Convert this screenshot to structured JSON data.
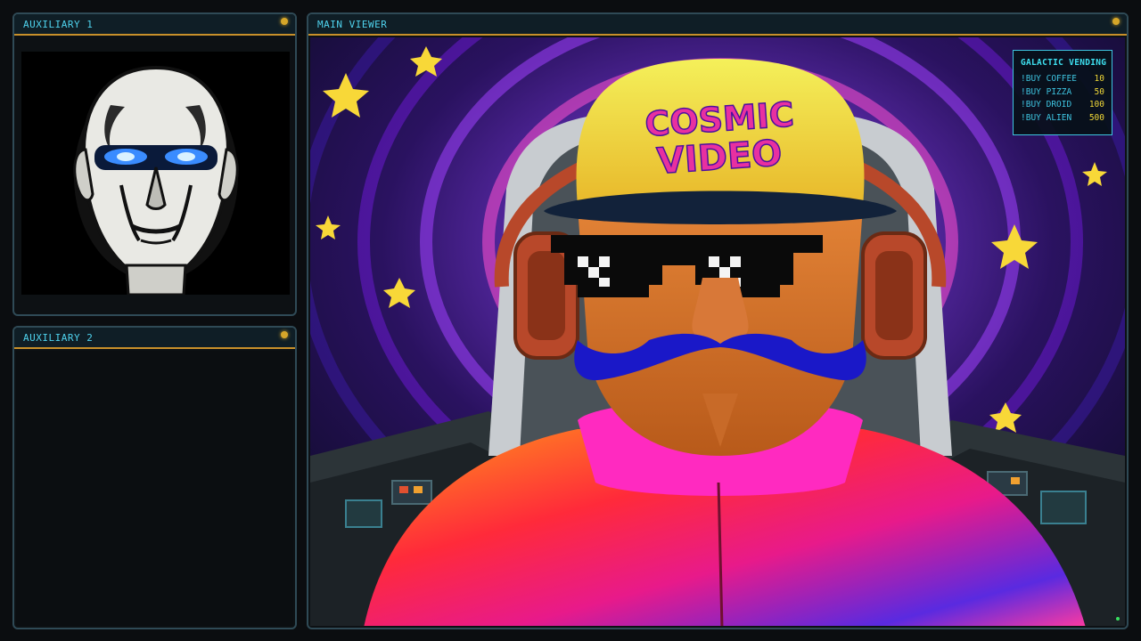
{
  "aux1": {
    "title": "AUXILIARY 1"
  },
  "aux2": {
    "title": "AUXILIARY 2"
  },
  "main": {
    "title": "MAIN VIEWER",
    "cap_text_line1": "COSMIC",
    "cap_text_line2": "VIDEO"
  },
  "vending": {
    "title": "GALACTIC VENDING",
    "items": [
      {
        "command": "!BUY COFFEE",
        "price": "10"
      },
      {
        "command": "!BUY PIZZA",
        "price": "50"
      },
      {
        "command": "!BUY DROID",
        "price": "100"
      },
      {
        "command": "!BUY ALIEN",
        "price": "500"
      }
    ]
  },
  "colors": {
    "accent": "#4fd3ee",
    "header_border": "#c8902a",
    "status_dot": "#d6a629",
    "price": "#f0d838"
  },
  "icons": [
    "status-dot",
    "power-led"
  ]
}
